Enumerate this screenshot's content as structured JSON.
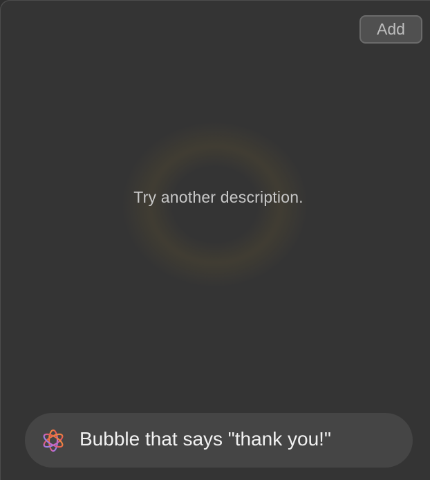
{
  "header": {
    "add_label": "Add"
  },
  "main": {
    "message": "Try another description."
  },
  "prompt": {
    "icon": "sparkle-flower-icon",
    "text": "Bubble that says \"thank you!\""
  },
  "colors": {
    "background": "#343434",
    "prompt_background": "#454545",
    "glow": "#786430"
  }
}
